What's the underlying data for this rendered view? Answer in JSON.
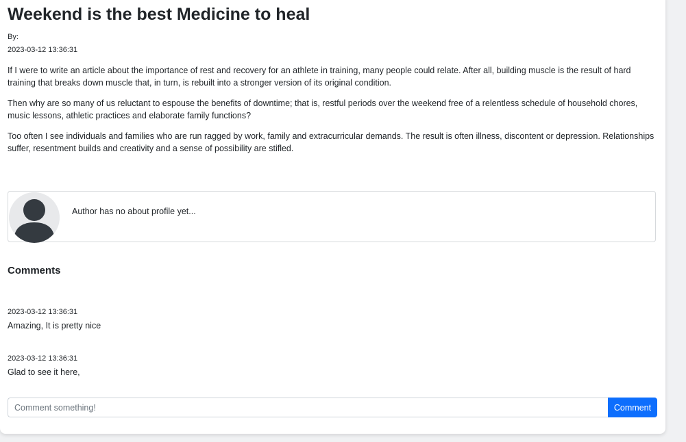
{
  "article": {
    "title": "Weekend is the best Medicine to heal",
    "by_label": "By:",
    "date": "2023-03-12 13:36:31",
    "paragraphs": [
      "If I were to write an article about the importance of rest and recovery for an athlete in training, many people could relate. After all, building muscle is the result of hard training that breaks down muscle that, in turn, is rebuilt into a stronger version of its original condition.",
      "Then why are so many of us reluctant to espouse the benefits of downtime; that is, restful periods over the weekend free of a relentless schedule of household chores, music lessons, athletic practices and elaborate family functions?",
      "Too often I see individuals and families who are run ragged by work, family and extracurricular demands. The result is often illness, discontent or depression. Relationships suffer, resentment builds and creativity and a sense of possibility are stifled."
    ]
  },
  "author": {
    "avatar_icon": "user-avatar-icon",
    "about": "Author has no about profile yet..."
  },
  "comments": {
    "heading": "Comments",
    "items": [
      {
        "date": "2023-03-12 13:36:31",
        "text": "Amazing, It is pretty nice"
      },
      {
        "date": "2023-03-12 13:36:31",
        "text": "Glad to see it here,"
      }
    ],
    "input_placeholder": "Comment something!",
    "input_value": "",
    "submit_label": "Comment"
  },
  "colors": {
    "primary": "#0d6efd",
    "text": "#212529",
    "avatar_fill": "#343a40",
    "avatar_bg": "#e8e9eb"
  }
}
